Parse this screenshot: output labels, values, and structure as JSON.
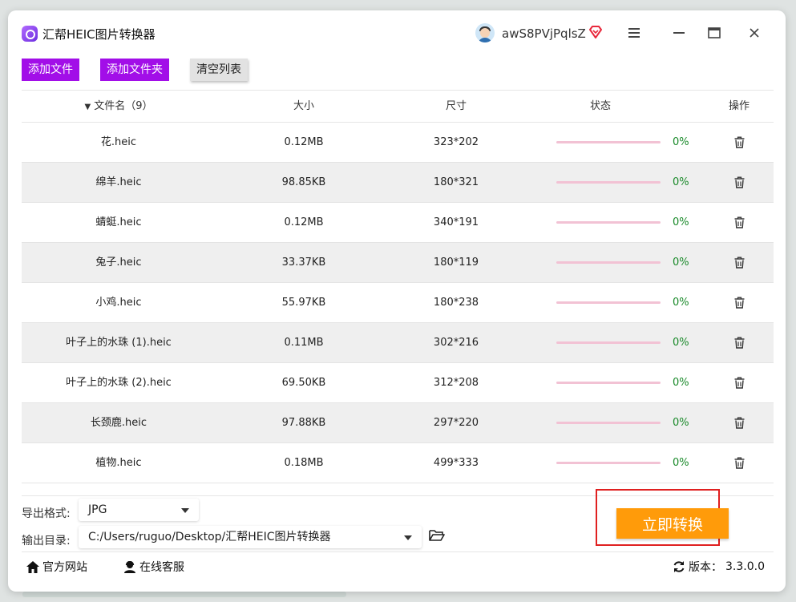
{
  "app": {
    "title": "汇帮HEIC图片转换器",
    "username": "awS8PVjPqlsZ"
  },
  "toolbar": {
    "add_file": "添加文件",
    "add_folder": "添加文件夹",
    "clear_list": "清空列表"
  },
  "table": {
    "headers": {
      "name": "文件名（9）",
      "size": "大小",
      "dimensions": "尺寸",
      "status": "状态",
      "action": "操作"
    },
    "rows": [
      {
        "name": "花.heic",
        "size": "0.12MB",
        "dimensions": "323*202",
        "progress": "0%"
      },
      {
        "name": "绵羊.heic",
        "size": "98.85KB",
        "dimensions": "180*321",
        "progress": "0%"
      },
      {
        "name": "蜻蜓.heic",
        "size": "0.12MB",
        "dimensions": "340*191",
        "progress": "0%"
      },
      {
        "name": "兔子.heic",
        "size": "33.37KB",
        "dimensions": "180*119",
        "progress": "0%"
      },
      {
        "name": "小鸡.heic",
        "size": "55.97KB",
        "dimensions": "180*238",
        "progress": "0%"
      },
      {
        "name": "叶子上的水珠 (1).heic",
        "size": "0.11MB",
        "dimensions": "302*216",
        "progress": "0%"
      },
      {
        "name": "叶子上的水珠 (2).heic",
        "size": "69.50KB",
        "dimensions": "312*208",
        "progress": "0%"
      },
      {
        "name": "长颈鹿.heic",
        "size": "97.88KB",
        "dimensions": "297*220",
        "progress": "0%"
      },
      {
        "name": "植物.heic",
        "size": "0.18MB",
        "dimensions": "499*333",
        "progress": "0%"
      }
    ]
  },
  "export": {
    "format_label": "导出格式:",
    "format_value": "JPG",
    "output_label": "输出目录:",
    "output_value": "C:/Users/ruguo/Desktop/汇帮HEIC图片转换器",
    "convert_button": "立即转换"
  },
  "footer": {
    "website": "官方网站",
    "support": "在线客服",
    "version_label": "版本：",
    "version": "3.3.0.0"
  },
  "colors": {
    "accent_purple": "#a20ee8",
    "convert_orange": "#ff9b0a",
    "progress_green": "#1a8a2a",
    "highlight_red": "#e02020"
  },
  "icons": [
    "app-logo-icon",
    "avatar-icon",
    "vip-diamond-icon",
    "menu-icon",
    "minimize-icon",
    "maximize-icon",
    "close-icon",
    "sort-down-icon",
    "trash-icon",
    "chevron-down-icon",
    "folder-open-icon",
    "home-icon",
    "user-headset-icon",
    "refresh-icon"
  ]
}
